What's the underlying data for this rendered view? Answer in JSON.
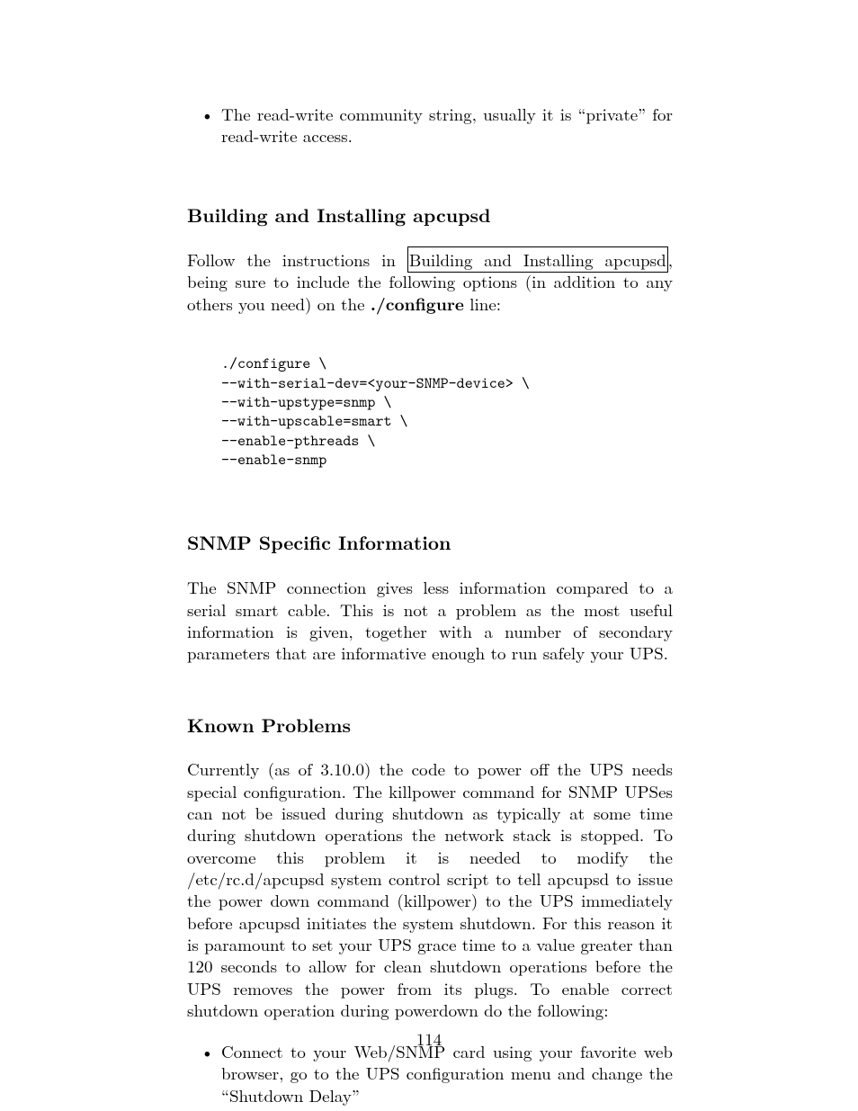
{
  "bullet1": "The read-write community string, usually it is “private” for read-write access.",
  "h_build": "Building and Installing apcupsd",
  "p_build_a": "Follow the instructions in ",
  "p_build_link": "Building and Installing apcupsd",
  "p_build_b": ", being sure to include the following options (in addition to any others you need) on the ",
  "p_build_c": "./configure",
  "p_build_d": " line:",
  "code": "./configure \\\n--with-serial-dev=<your-SNMP-device> \\\n--with-upstype=snmp \\\n--with-upscable=smart \\\n--enable-pthreads \\\n--enable-snmp",
  "h_snmp": "SNMP Specific Information",
  "p_snmp": "The SNMP connection gives less information compared to a serial smart cable. This is not a problem as the most useful information is given, together with a number of secondary parameters that are informative enough to run safely your UPS.",
  "h_known": "Known Problems",
  "p_known": "Currently (as of 3.10.0) the code to power off the UPS needs special configuration. The killpower command for SNMP UPSes can not be issued during shutdown as typically at some time during shutdown operations the network stack is stopped. To overcome this problem it is needed to modify the /etc/rc.d/apcupsd system control script to tell apcupsd to issue the power down command (killpower) to the UPS immediately before apcupsd initiates the system shutdown. For this reason it is paramount to set your UPS grace time to a value greater than 120 seconds to allow for clean shutdown operations before the UPS removes the power from its plugs. To enable correct shutdown operation during powerdown do the following:",
  "bullet2": "Connect to your Web/SNMP card using your favorite web browser, go to the UPS configuration menu and change the “Shutdown Delay”",
  "page_number": "114"
}
